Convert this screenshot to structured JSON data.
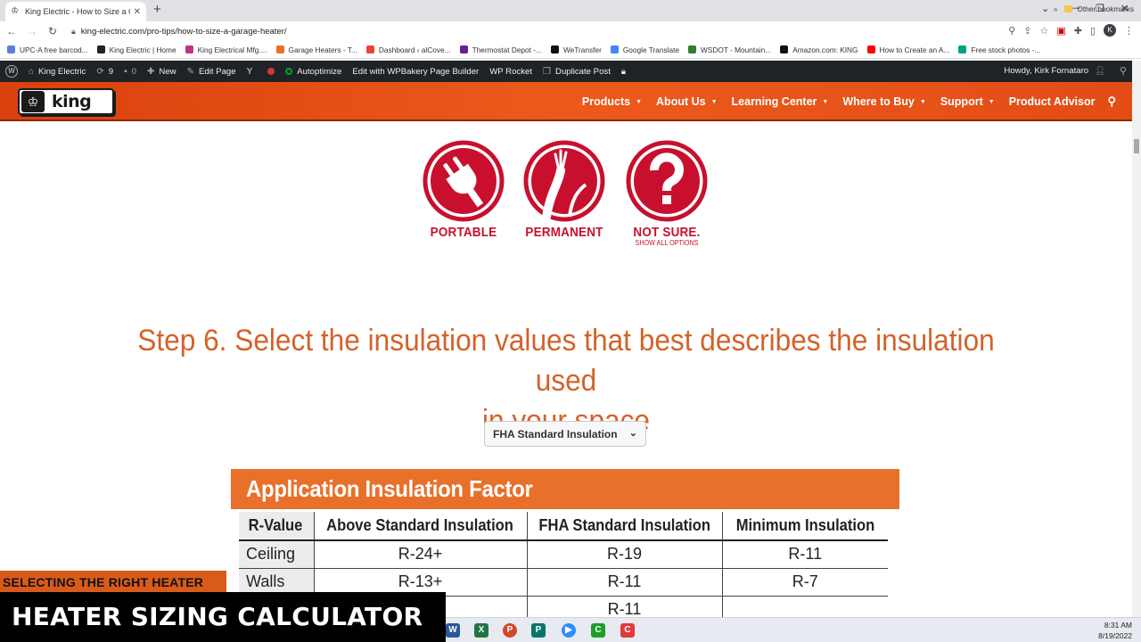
{
  "browser": {
    "tab_title": "King Electric - How to Size a Garage",
    "url": "king-electric.com/pro-tips/how-to-size-a-garage-heater/",
    "profile_initial": "K",
    "bookmarks": [
      {
        "label": "UPC-A free barcod...",
        "color": "#5b7fd6"
      },
      {
        "label": "King Electric | Home",
        "color": "#222222"
      },
      {
        "label": "King Electrical Mfg....",
        "color": "#c13584"
      },
      {
        "label": "Garage Heaters - T...",
        "color": "#e8702a"
      },
      {
        "label": "Dashboard ‹ alCove...",
        "color": "#e8453c"
      },
      {
        "label": "Thermostat Depot -...",
        "color": "#6a1b9a"
      },
      {
        "label": "WeTransfer",
        "color": "#111111"
      },
      {
        "label": "Google Translate",
        "color": "#4285f4"
      },
      {
        "label": "WSDOT - Mountain...",
        "color": "#2e7d32"
      },
      {
        "label": "Amazon.com: KING",
        "color": "#111111"
      },
      {
        "label": "How to Create an A...",
        "color": "#ff0000"
      },
      {
        "label": "Free stock photos -...",
        "color": "#05a081"
      }
    ],
    "other_bookmarks": "Other bookmarks"
  },
  "adminbar": {
    "site_name": "King Electric",
    "updates_count": "9",
    "comments_count": "0",
    "new_label": "New",
    "edit_label": "Edit Page",
    "autoptimize_label": "Autoptimize",
    "wpbakery_label": "Edit with WPBakery Page Builder",
    "wprocket_label": "WP Rocket",
    "duplicate_label": "Duplicate Post",
    "howdy": "Howdy, Kirk Fornataro"
  },
  "site": {
    "logo_text": "king",
    "nav": [
      "Products",
      "About Us",
      "Learning Center",
      "Where to Buy",
      "Support",
      "Product Advisor"
    ]
  },
  "options": [
    {
      "label": "PORTABLE",
      "sub": ""
    },
    {
      "label": "PERMANENT",
      "sub": ""
    },
    {
      "label": "NOT SURE.",
      "sub": "SHOW ALL OPTIONS"
    }
  ],
  "step": {
    "line1": "Step 6. Select the insulation values that best describes the insulation used",
    "line2": "in your space"
  },
  "insulation_select": {
    "value": "FHA Standard Insulation"
  },
  "factor_table": {
    "title": "Application Insulation Factor",
    "headers": [
      "R-Value",
      "Above Standard Insulation",
      "FHA Standard Insulation",
      "Minimum Insulation"
    ],
    "rows": [
      [
        "Ceiling",
        "R-24+",
        "R-19",
        "R-11"
      ],
      [
        "Walls",
        "R-13+",
        "R-11",
        "R-7"
      ],
      [
        "",
        "",
        "R-11",
        ""
      ]
    ]
  },
  "overlay": {
    "top": "SELECTING THE RIGHT HEATER",
    "bottom": "HEATER SIZING CALCULATOR"
  },
  "taskbar": {
    "time": "8:31 AM",
    "date": "8/19/2022"
  },
  "colors": {
    "brand_orange": "#e8702a",
    "option_red": "#c8102e",
    "step_orange": "#d4622a"
  }
}
